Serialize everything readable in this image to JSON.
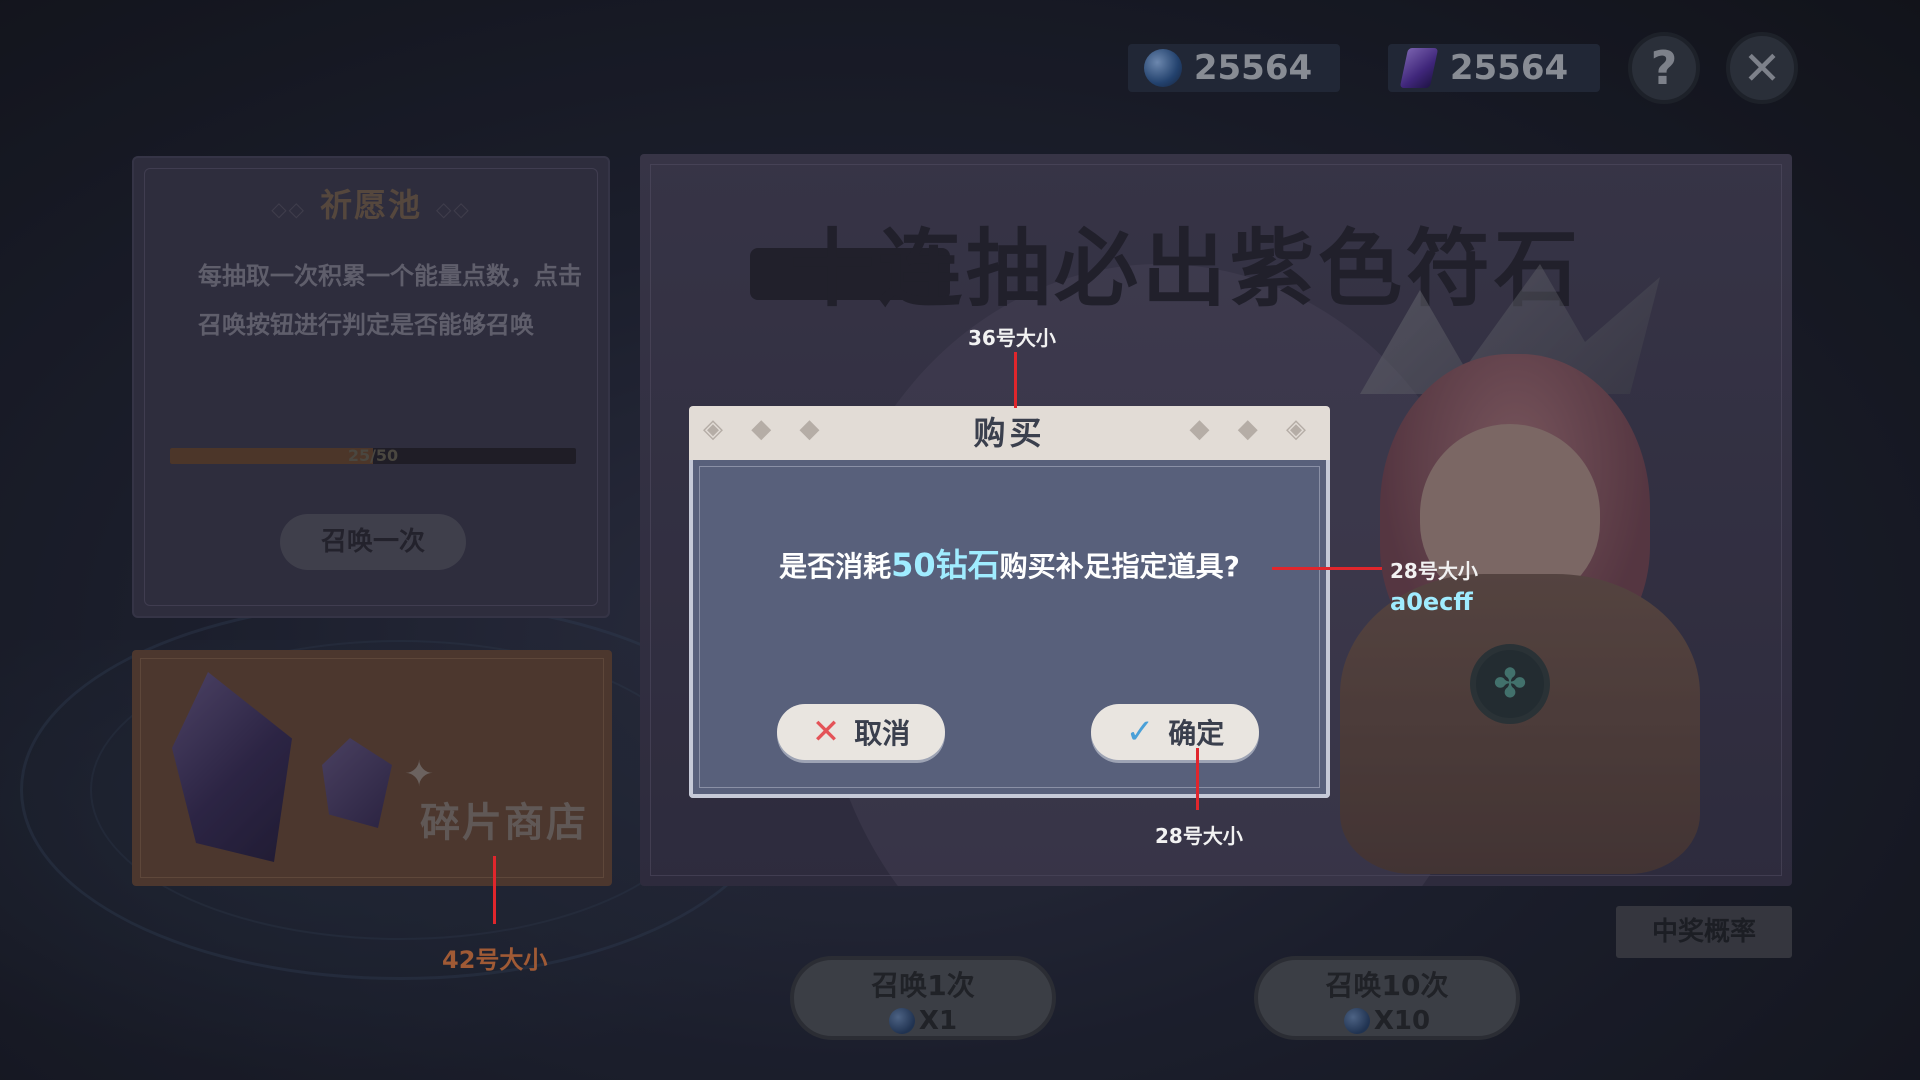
{
  "currencies": [
    {
      "icon": "blue-diamond-icon",
      "value": "25564"
    },
    {
      "icon": "purple-crystal-icon",
      "value": "25564"
    }
  ],
  "top_buttons": {
    "help": "?",
    "close": "✕"
  },
  "wish_pool": {
    "title": "祈愿池",
    "description": "每抽取一次积累一个能量点数，点击召唤按钮进行判定是否能够召唤",
    "progress_text": "25/50",
    "progress_fraction": 0.5,
    "summon_button": "召唤一次"
  },
  "shop": {
    "label": "碎片商店"
  },
  "banner": {
    "title": "十连抽必出紫色符石"
  },
  "probability_button": "中奖概率",
  "summon_buttons": [
    {
      "label": "召唤1次",
      "cost": "X1"
    },
    {
      "label": "召唤10次",
      "cost": "X10"
    }
  ],
  "dialog": {
    "title": "购买",
    "message_pre": "是否消耗",
    "message_highlight": "50钻石",
    "message_post": "购买补足指定道具?",
    "cancel": "取消",
    "confirm": "确定"
  },
  "annotations": {
    "title_size": "36号大小",
    "msg_size": "28号大小",
    "msg_color": "a0ecff",
    "btn_size": "28号大小",
    "shop_size": "42号大小"
  },
  "colors": {
    "highlight": "#a0ecff",
    "annotation_line": "#e0262c"
  }
}
